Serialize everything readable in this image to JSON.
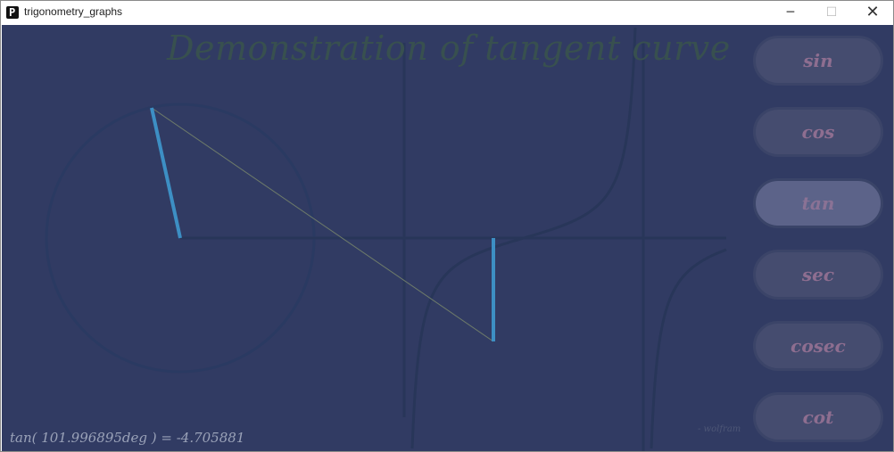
{
  "window": {
    "title": "trigonometry_graphs",
    "app_icon_glyph": "P",
    "controls": {
      "minimize": "─",
      "maximize": "☐",
      "close": "✕"
    }
  },
  "canvas": {
    "heading": "Demonstration of tangent curve",
    "formula": "tan( 101.996895deg ) = -4.705881",
    "credit": "- wolfram",
    "angle_deg": 101.996895,
    "tan_value": -4.705881
  },
  "functions": [
    {
      "label": "sin",
      "active": false
    },
    {
      "label": "cos",
      "active": false
    },
    {
      "label": "tan",
      "active": true
    },
    {
      "label": "sec",
      "active": false
    },
    {
      "label": "cosec",
      "active": false
    },
    {
      "label": "cot",
      "active": false
    }
  ],
  "colors": {
    "background": "#313b63",
    "circle": "#2a3a62",
    "radius": "#3d8fc4",
    "curve": "#283659",
    "heading": "#38504f",
    "button": "#454c6f",
    "button_active": "#5c6389",
    "button_text": "#8e6e90"
  }
}
